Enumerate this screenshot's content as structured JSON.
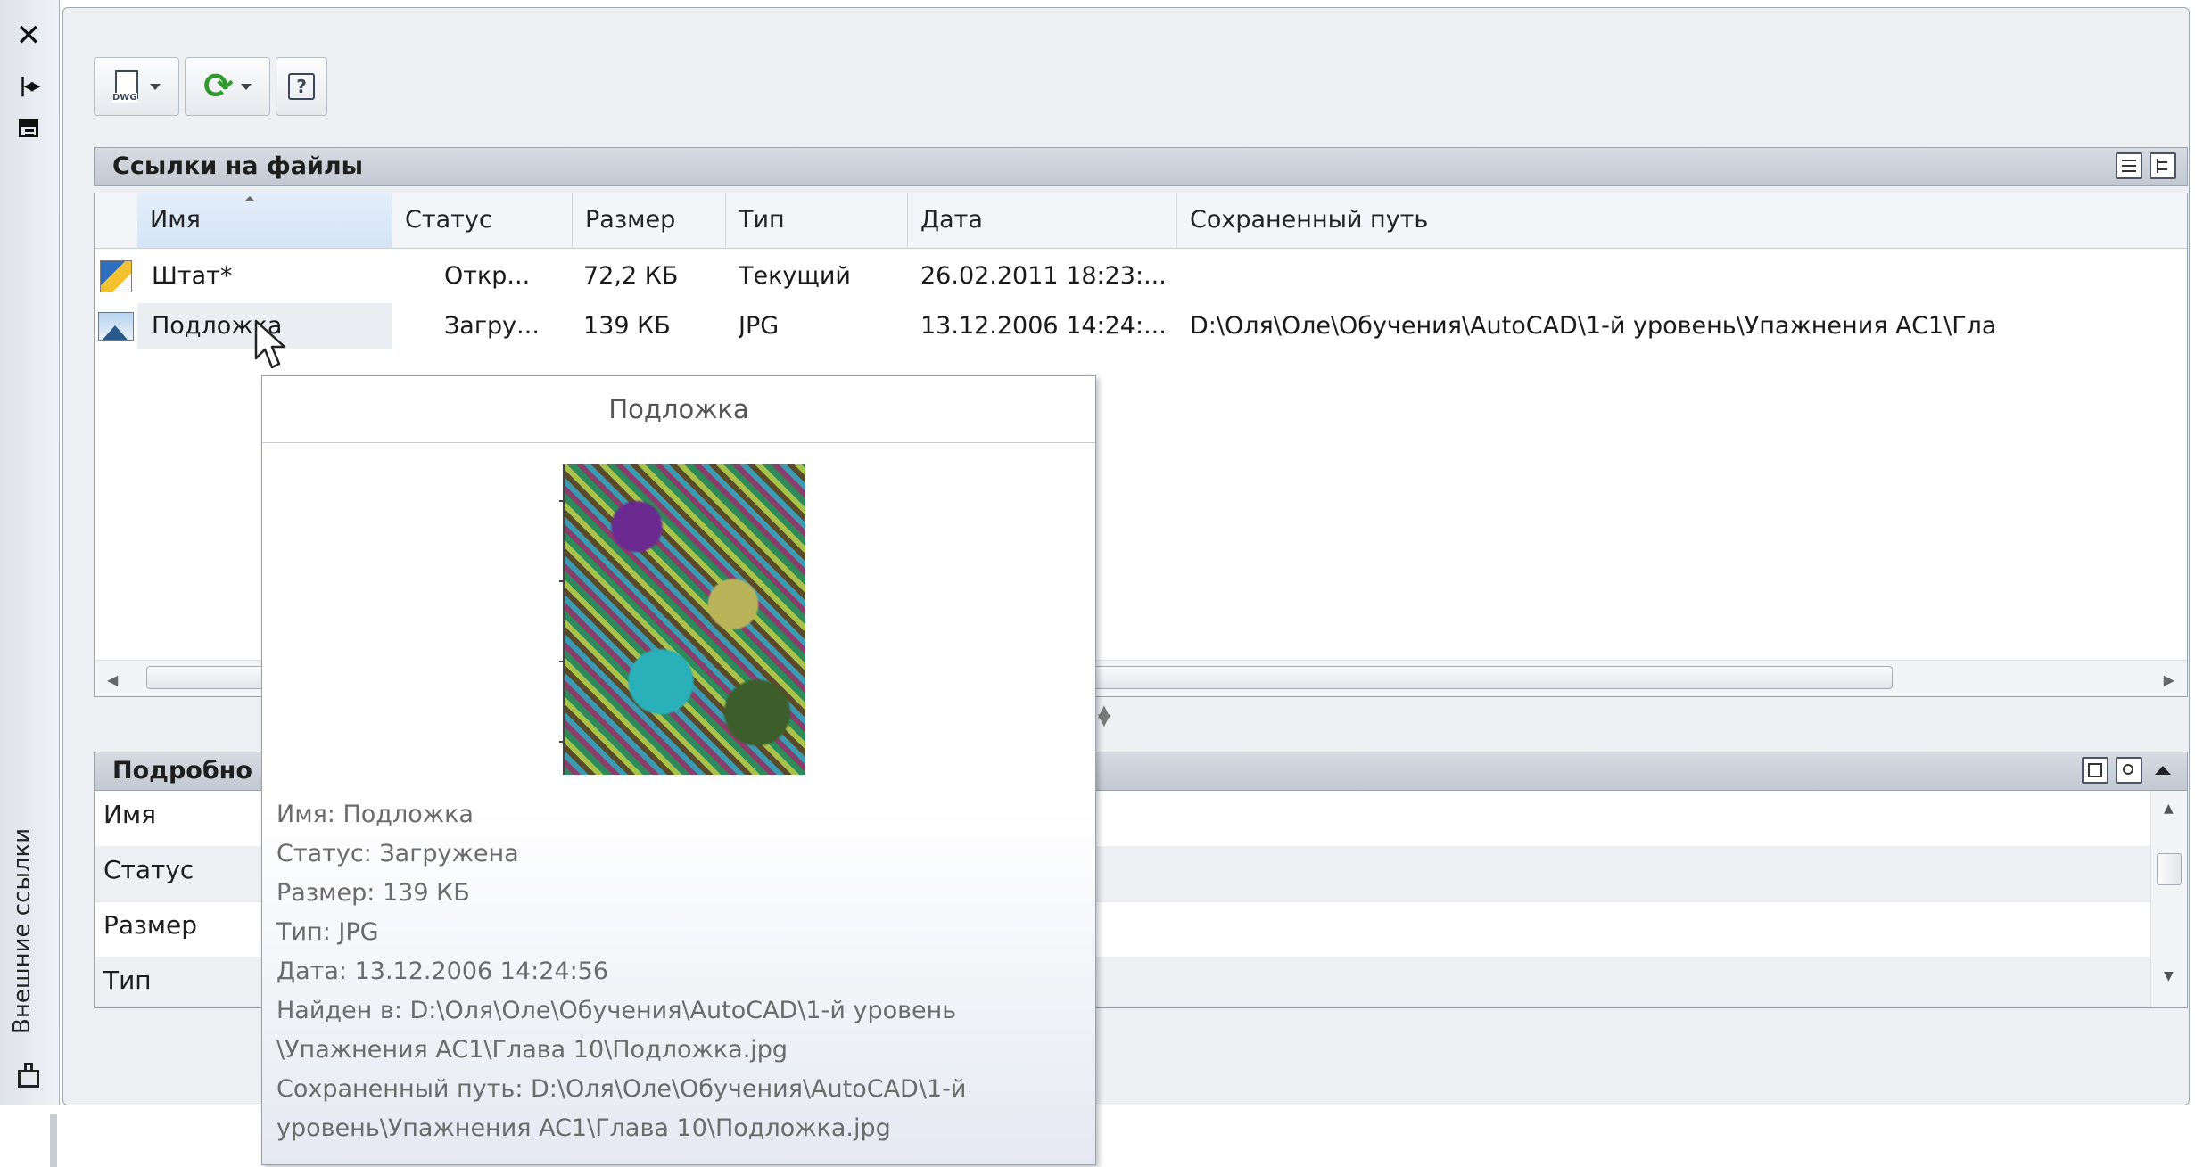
{
  "palette": {
    "vertical_title": "Внешние ссылки"
  },
  "file_refs": {
    "header": "Ссылки на файлы",
    "columns": [
      "Имя",
      "Статус",
      "Размер",
      "Тип",
      "Дата",
      "Сохраненный путь"
    ],
    "rows": [
      {
        "name": "Штат*",
        "status": "Откр...",
        "size": "72,2 КБ",
        "type": "Текущий",
        "date": "26.02.2011 18:23:...",
        "path": ""
      },
      {
        "name": "Подложка",
        "status": "Загру...",
        "size": "139 КБ",
        "type": "JPG",
        "date": "13.12.2006 14:24:...",
        "path": "D:\\Оля\\Оле\\Обучения\\AutoCAD\\1-й уровень\\Упажнения AC1\\Гла"
      }
    ]
  },
  "details": {
    "header": "Подробно",
    "labels": [
      "Имя",
      "Статус",
      "Размер",
      "Тип"
    ]
  },
  "tooltip": {
    "title": "Подложка",
    "lines": [
      "Имя: Подложка",
      "Статус: Загружена",
      "Размер: 139 КБ",
      "Тип: JPG",
      "Дата: 13.12.2006 14:24:56",
      "Найден в: D:\\Оля\\Оле\\Обучения\\AutoCAD\\1-й уровень",
      "\\Упажнения AC1\\Глава 10\\Подложка.jpg",
      "Сохраненный путь: D:\\Оля\\Оле\\Обучения\\AutoCAD\\1-й",
      "уровень\\Упажнения AC1\\Глава 10\\Подложка.jpg"
    ]
  },
  "icons": {
    "close": "close-icon",
    "autohide": "autohide-icon",
    "properties": "properties-icon",
    "attach_dwg": "attach-dwg-icon",
    "refresh": "refresh-icon",
    "help": "help-icon"
  },
  "colors": {
    "refresh_green": "#2f9b2c",
    "header_bg": "#c3c9d2",
    "selected_column": "#d5e4f5"
  }
}
